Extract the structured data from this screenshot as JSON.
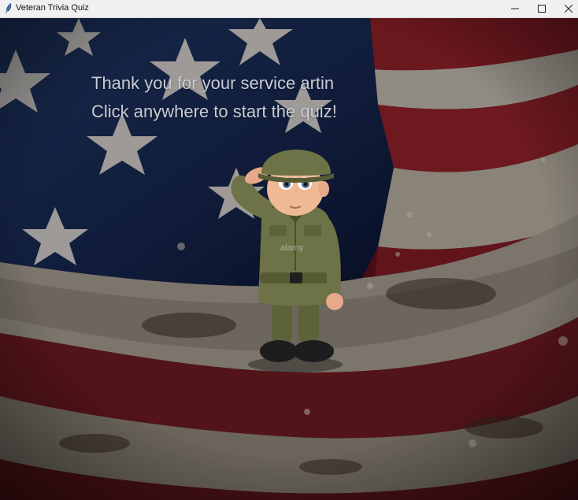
{
  "window": {
    "title": "Veteran Trivia Quiz",
    "controls": {
      "minimize": "minimize-icon",
      "maximize": "maximize-icon",
      "close": "close-icon"
    }
  },
  "canvas": {
    "line1": "Thank you for your service artin",
    "line2": "Click anywhere to start the quiz!",
    "background": "american-flag-image",
    "character": "saluting-soldier-image",
    "watermark": "alamy"
  },
  "colors": {
    "text": "#c9ccd4",
    "flag_blue": "#1a2a52",
    "flag_red": "#6a1b22",
    "uniform": "#6d7346"
  }
}
